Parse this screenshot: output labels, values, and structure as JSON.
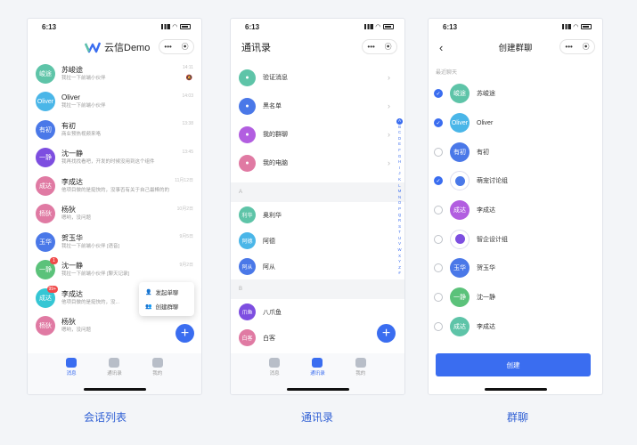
{
  "status_time": "6:13",
  "colors": {
    "accent": "#3a6df0",
    "teal": "#5ec4a8",
    "sky": "#4ab6e8",
    "blue": "#4a78e8",
    "purple": "#7d4ee0",
    "pink": "#e07aa3",
    "violet": "#b25ee0",
    "orange": "#f08c55",
    "cyan": "#35c6d4",
    "green": "#5bc27a"
  },
  "conversations": {
    "brand_name": "云信Demo",
    "capsule_more": "•••",
    "capsule_close": "⦿",
    "items": [
      {
        "avatar": "峻途",
        "name": "苏峻途",
        "msg": "我拉一下前端小伙伴",
        "time": "14:11",
        "color": "#5ec4a8",
        "mute": true,
        "badge": ""
      },
      {
        "avatar": "Oliver",
        "name": "Oliver",
        "msg": "我拉一下前端小伙伴",
        "time": "14:03",
        "color": "#4ab6e8",
        "mute": false,
        "badge": ""
      },
      {
        "avatar": "有初",
        "name": "有初",
        "msg": "商业预热视频来咯",
        "time": "13:38",
        "color": "#4a78e8",
        "mute": false,
        "badge": ""
      },
      {
        "avatar": "一静",
        "name": "沈一静",
        "msg": "我再找找看吧，开发的时候没用到这个组件",
        "time": "13:45",
        "color": "#7d4ee0",
        "mute": false,
        "badge": ""
      },
      {
        "avatar": "成达",
        "name": "李成达",
        "msg": "他项目做的是挺快的，没事否有关于自己最棒的的",
        "time": "11月12日",
        "color": "#e07aa3",
        "mute": false,
        "badge": ""
      },
      {
        "avatar": "杨狄",
        "name": "杨狄",
        "msg": "嗯哟，没问题",
        "time": "10月2日",
        "color": "#e07aa3",
        "mute": false,
        "badge": ""
      },
      {
        "avatar": "玉华",
        "name": "贺玉华",
        "msg": "我拉一下前端小伙伴 [语音]",
        "time": "9月5日",
        "color": "#4a78e8",
        "mute": false,
        "badge": ""
      },
      {
        "avatar": "一静",
        "name": "沈一静",
        "msg": "我拉一下前端小伙伴 [聊天记录]",
        "time": "9月2日",
        "color": "#5bc27a",
        "mute": false,
        "badge": "1"
      },
      {
        "avatar": "成达",
        "name": "李成达",
        "msg": "他项目做的是挺快的，没...",
        "time": "",
        "color": "#35c6d4",
        "mute": false,
        "badge": "99+"
      },
      {
        "avatar": "杨狄",
        "name": "杨狄",
        "msg": "嗯哟，没问题",
        "time": "",
        "color": "#e07aa3",
        "mute": false,
        "badge": ""
      }
    ],
    "popup": {
      "item1": "发起单聊",
      "item2": "创建群聊"
    },
    "fab": "+",
    "tabs": {
      "messages": "消息",
      "contacts": "通讯录",
      "me": "我的"
    }
  },
  "contacts": {
    "title": "通讯录",
    "capsule_more": "•••",
    "capsule_close": "⦿",
    "functions": [
      {
        "label": "验证消息",
        "color": "#5ec4a8"
      },
      {
        "label": "黑名单",
        "color": "#4a78e8"
      },
      {
        "label": "我的群聊",
        "color": "#b25ee0"
      },
      {
        "label": "我的电脑",
        "color": "#e07aa3"
      }
    ],
    "section_a": "A",
    "section_b": "B",
    "group_a": [
      {
        "avatar": "利华",
        "name": "奥利华",
        "color": "#5ec4a8"
      },
      {
        "avatar": "阿德",
        "name": "阿德",
        "color": "#4ab6e8"
      },
      {
        "avatar": "阿从",
        "name": "阿从",
        "color": "#4a78e8"
      }
    ],
    "group_b": [
      {
        "avatar": "爪鱼",
        "name": "八爪鱼",
        "color": "#7d4ee0"
      },
      {
        "avatar": "白客",
        "name": "白客",
        "color": "#e07aa3"
      }
    ],
    "index_letters": [
      "A",
      "B",
      "C",
      "D",
      "E",
      "F",
      "G",
      "H",
      "I",
      "J",
      "K",
      "L",
      "M",
      "N",
      "O",
      "P",
      "Q",
      "R",
      "S",
      "T",
      "U",
      "V",
      "W",
      "X",
      "Y",
      "Z",
      "#"
    ],
    "fab": "+",
    "tabs": {
      "messages": "消息",
      "contacts": "通讯录",
      "me": "我的"
    }
  },
  "group": {
    "title": "创建群聊",
    "back": "‹",
    "capsule_more": "•••",
    "capsule_close": "⦿",
    "recent_label": "最近聊天",
    "items": [
      {
        "avatar": "峻途",
        "name": "苏峻途",
        "checked": true,
        "type": "person",
        "color": "#5ec4a8"
      },
      {
        "avatar": "Oliver",
        "name": "Oliver",
        "checked": true,
        "type": "person",
        "color": "#4ab6e8"
      },
      {
        "avatar": "有初",
        "name": "有初",
        "checked": false,
        "type": "person",
        "color": "#4a78e8"
      },
      {
        "avatar": "",
        "name": "萌宠讨论组",
        "checked": true,
        "type": "team",
        "color": "#4a78e8"
      },
      {
        "avatar": "成达",
        "name": "李成达",
        "checked": false,
        "type": "person",
        "color": "#b25ee0"
      },
      {
        "avatar": "",
        "name": "智企设计组",
        "checked": false,
        "type": "team",
        "color": "#7d4ee0"
      },
      {
        "avatar": "玉华",
        "name": "贺玉华",
        "checked": false,
        "type": "person",
        "color": "#4a78e8"
      },
      {
        "avatar": "一静",
        "name": "沈一静",
        "checked": false,
        "type": "person",
        "color": "#5bc27a"
      },
      {
        "avatar": "成达",
        "name": "李成达",
        "checked": false,
        "type": "person",
        "color": "#5ec4a8"
      }
    ],
    "create_label": "创建"
  },
  "captions": {
    "left": "会话列表",
    "middle": "通讯录",
    "right": "群聊"
  }
}
